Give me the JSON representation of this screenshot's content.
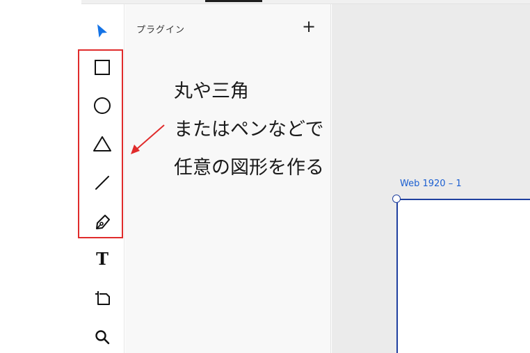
{
  "toolbar": {
    "tools": [
      {
        "name": "select",
        "icon": "pointer-arrow-icon"
      },
      {
        "name": "rectangle",
        "icon": "rectangle-icon"
      },
      {
        "name": "ellipse",
        "icon": "ellipse-icon"
      },
      {
        "name": "polygon",
        "icon": "triangle-icon"
      },
      {
        "name": "line",
        "icon": "line-icon"
      },
      {
        "name": "pen",
        "icon": "pen-nib-icon"
      },
      {
        "name": "text",
        "icon": "text-icon",
        "glyph": "T"
      },
      {
        "name": "artboard",
        "icon": "artboard-icon"
      },
      {
        "name": "zoom",
        "icon": "magnifier-icon"
      }
    ],
    "accent_color": "#1473e6",
    "highlight_color": "#e02b2b"
  },
  "plugin_panel": {
    "title": "プラグイン",
    "add_label": "+"
  },
  "canvas": {
    "artboard_label": "Web 1920 – 1",
    "artboard_color": "#1f3f9f"
  },
  "annotation": {
    "lines": [
      "丸や三角",
      "またはペンなどで",
      "任意の図形を作る"
    ],
    "arrow_color": "#e02b2b"
  }
}
